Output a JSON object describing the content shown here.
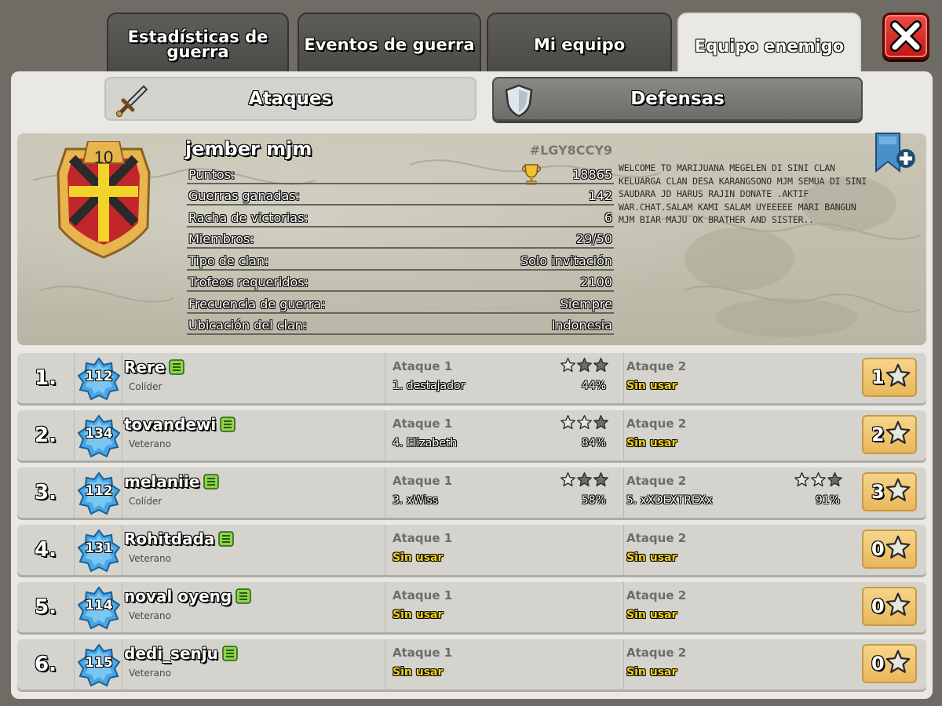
{
  "tabs": [
    {
      "label": "Estadísticas de guerra"
    },
    {
      "label": "Eventos de guerra"
    },
    {
      "label": "Mi equipo"
    },
    {
      "label": "Equipo enemigo"
    }
  ],
  "close_label": "X",
  "subtabs": {
    "attacks": "Ataques",
    "defenses": "Defensas"
  },
  "clan": {
    "level": "10",
    "name": "jember mjm",
    "tag": "#LGY8CCY9",
    "stats": [
      {
        "label": "Puntos:",
        "value": "18865"
      },
      {
        "label": "Guerras ganadas:",
        "value": "142"
      },
      {
        "label": "Racha de victorias:",
        "value": "6"
      },
      {
        "label": "Miembros:",
        "value": "29/50"
      },
      {
        "label": "Tipo de clan:",
        "value": "Solo invitación"
      },
      {
        "label": "Trofeos requeridos:",
        "value": "2100"
      },
      {
        "label": "Frecuencia de guerra:",
        "value": "Siempre"
      },
      {
        "label": "Ubicación del clan:",
        "value": "Indonesia"
      }
    ],
    "description": "WELCOME TO MARIJUANA MEGELEN DI SINI CLAN KELUARGA CLAN DESA KARANGSONO MJM SEMUA DI SINI SAUDARA JD HARUS RAJIN DONATE .AKTIF WAR.CHAT.SALAM KAMI SALAM UYEEEEE MARI BANGUN MJM BIAR MAJU OK BRATHER AND SISTER.."
  },
  "members": [
    {
      "rank": "1.",
      "level": "112",
      "name": "Rere",
      "role": "Colíder",
      "attack1": {
        "label": "Ataque 1",
        "target": "1. destajador",
        "percent": "44%",
        "stars": 1,
        "unused": false
      },
      "attack2": {
        "label": "Ataque 2",
        "target": "Sin usar",
        "percent": "",
        "stars": null,
        "unused": true
      },
      "total_stars": "1"
    },
    {
      "rank": "2.",
      "level": "134",
      "name": "tovandewi",
      "role": "Veterano",
      "attack1": {
        "label": "Ataque 1",
        "target": "4. Elizabeth",
        "percent": "84%",
        "stars": 2,
        "unused": false
      },
      "attack2": {
        "label": "Ataque 2",
        "target": "Sin usar",
        "percent": "",
        "stars": null,
        "unused": true
      },
      "total_stars": "2"
    },
    {
      "rank": "3.",
      "level": "112",
      "name": "melaniie",
      "role": "Colíder",
      "attack1": {
        "label": "Ataque 1",
        "target": "3. xWiss",
        "percent": "58%",
        "stars": 1,
        "unused": false
      },
      "attack2": {
        "label": "Ataque 2",
        "target": "5. xXDEXTREXx",
        "percent": "91%",
        "stars": 2,
        "unused": false
      },
      "total_stars": "3"
    },
    {
      "rank": "4.",
      "level": "131",
      "name": "Rohitdada",
      "role": "Veterano",
      "attack1": {
        "label": "Ataque 1",
        "target": "Sin usar",
        "percent": "",
        "stars": null,
        "unused": true
      },
      "attack2": {
        "label": "Ataque 2",
        "target": "Sin usar",
        "percent": "",
        "stars": null,
        "unused": true
      },
      "total_stars": "0"
    },
    {
      "rank": "5.",
      "level": "114",
      "name": "noval oyeng",
      "role": "Veterano",
      "attack1": {
        "label": "Ataque 1",
        "target": "Sin usar",
        "percent": "",
        "stars": null,
        "unused": true
      },
      "attack2": {
        "label": "Ataque 2",
        "target": "Sin usar",
        "percent": "",
        "stars": null,
        "unused": true
      },
      "total_stars": "0"
    },
    {
      "rank": "6.",
      "level": "115",
      "name": "dedi_senju",
      "role": "Veterano",
      "attack1": {
        "label": "Ataque 1",
        "target": "Sin usar",
        "percent": "",
        "stars": null,
        "unused": true
      },
      "attack2": {
        "label": "Ataque 2",
        "target": "Sin usar",
        "percent": "",
        "stars": null,
        "unused": true
      },
      "total_stars": "0"
    }
  ],
  "colors": {
    "unused_text": "#f6d21b",
    "close_red": "#d9261f",
    "total_gold": "#e9b75a"
  }
}
